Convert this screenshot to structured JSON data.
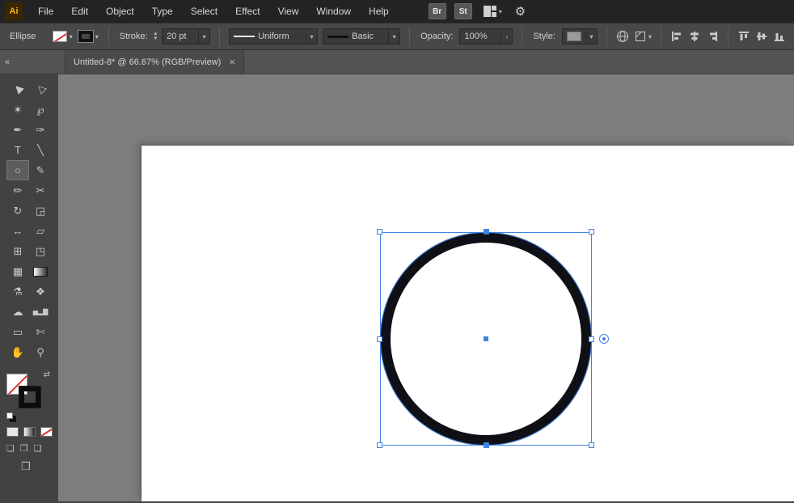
{
  "colors": {
    "menubar_bg": "#232323",
    "controlbar_bg": "#484848",
    "panel_bg": "#424242",
    "strip_bg": "#535353",
    "tab_bg": "#4a4a4a",
    "canvas_bg": "#7d7d7d",
    "artboard_white": "#ffffff",
    "selection_blue": "#4083e0",
    "ring_black": "#0f0f16",
    "text_light": "#d6d6d6",
    "logo_orange": "#ffb11b",
    "field_bg": "#3a3a3a",
    "none_red": "#e03131"
  },
  "icons": {
    "chevron": "▾",
    "stepper_up": "▴",
    "stepper_down": "▾",
    "submenu_arrow": "›",
    "close": "×",
    "collapse": "«",
    "swap": "⇄",
    "gear": "⚙"
  },
  "menubar": {
    "logo": "Ai",
    "menus": [
      "File",
      "Edit",
      "Object",
      "Type",
      "Select",
      "Effect",
      "View",
      "Window",
      "Help"
    ],
    "bridge_badge": "Br",
    "stock_badge": "St"
  },
  "control_bar": {
    "context_label": "Ellipse",
    "stroke_label": "Stroke:",
    "stroke_weight": "20 pt",
    "width_profile": "Uniform",
    "brush": "Basic",
    "opacity_label": "Opacity:",
    "opacity_value": "100%",
    "style_label": "Style:"
  },
  "tab": {
    "title": "Untitled-8* @ 66.67% (RGB/Preview)"
  },
  "toolbar": {
    "tools": [
      {
        "name": "selection",
        "glyph": "▶"
      },
      {
        "name": "direct-selection",
        "glyph": "▷"
      },
      {
        "name": "magic-wand",
        "glyph": "✶"
      },
      {
        "name": "lasso",
        "glyph": "℘"
      },
      {
        "name": "pen",
        "glyph": "✒"
      },
      {
        "name": "curvature",
        "glyph": "✑"
      },
      {
        "name": "type",
        "glyph": "T"
      },
      {
        "name": "line-segment",
        "glyph": "╲"
      },
      {
        "name": "ellipse",
        "glyph": "○",
        "selected": true
      },
      {
        "name": "paintbrush",
        "glyph": "✎"
      },
      {
        "name": "pencil",
        "glyph": "✏"
      },
      {
        "name": "scissors",
        "glyph": "✂"
      },
      {
        "name": "rotate",
        "glyph": "↻"
      },
      {
        "name": "scale",
        "glyph": "◲"
      },
      {
        "name": "width",
        "glyph": "↔"
      },
      {
        "name": "free-transform",
        "glyph": "▱"
      },
      {
        "name": "shape-builder",
        "glyph": "⊞"
      },
      {
        "name": "perspective-grid",
        "glyph": "◳"
      },
      {
        "name": "mesh",
        "glyph": "▦"
      },
      {
        "name": "gradient",
        "glyph": ""
      },
      {
        "name": "eyedropper",
        "glyph": "⚗"
      },
      {
        "name": "blend",
        "glyph": "❖"
      },
      {
        "name": "symbol-sprayer",
        "glyph": "☁"
      },
      {
        "name": "column-graph",
        "glyph": "▅▂▇"
      },
      {
        "name": "artboard",
        "glyph": "▭"
      },
      {
        "name": "slice",
        "glyph": "✄"
      },
      {
        "name": "hand",
        "glyph": "✋"
      },
      {
        "name": "zoom",
        "glyph": "⚲"
      }
    ],
    "modes": {
      "normal": "❏",
      "behind": "❐",
      "inside": "❑",
      "screen": "❒"
    }
  }
}
